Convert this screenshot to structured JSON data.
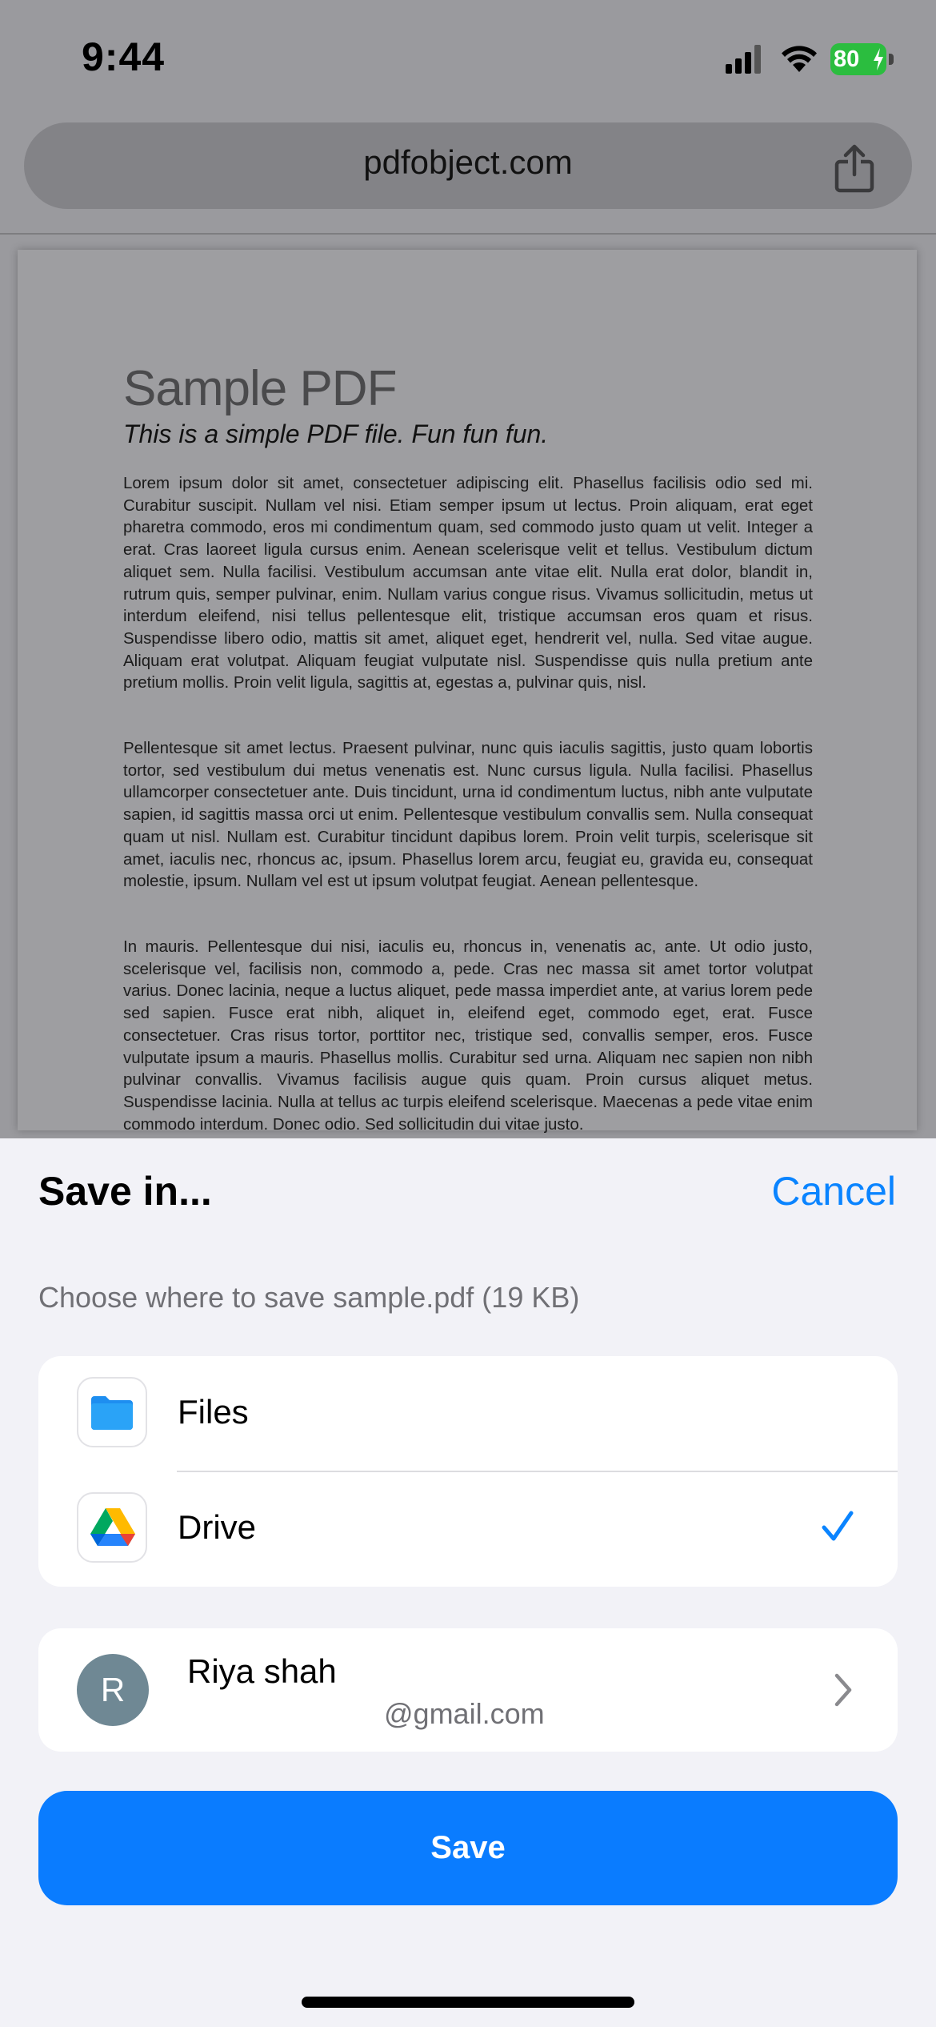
{
  "status_bar": {
    "time": "9:44",
    "battery": "80"
  },
  "browser": {
    "url": "pdfobject.com"
  },
  "pdf": {
    "title": "Sample PDF",
    "subtitle": "This is a simple PDF file. Fun fun fun.",
    "paragraphs": [
      "Lorem ipsum dolor sit amet, consectetuer adipiscing elit. Phasellus facilisis odio sed mi. Curabitur suscipit. Nullam vel nisi. Etiam semper ipsum ut lectus. Proin aliquam, erat eget pharetra commodo, eros mi condimentum quam, sed commodo justo quam ut velit. Integer a erat. Cras laoreet ligula cursus enim. Aenean scelerisque velit et tellus. Vestibulum dictum aliquet sem. Nulla facilisi. Vestibulum accumsan ante vitae elit. Nulla erat dolor, blandit in, rutrum quis, semper pulvinar, enim. Nullam varius congue risus. Vivamus sollicitudin, metus ut interdum eleifend, nisi tellus pellentesque elit, tristique accumsan eros quam et risus. Suspendisse libero odio, mattis sit amet, aliquet eget, hendrerit vel, nulla. Sed vitae augue. Aliquam erat volutpat. Aliquam feugiat vulputate nisl. Suspendisse quis nulla pretium ante pretium mollis. Proin velit ligula, sagittis at, egestas a, pulvinar quis, nisl.",
      "Pellentesque sit amet lectus. Praesent pulvinar, nunc quis iaculis sagittis, justo quam lobortis tortor, sed vestibulum dui metus venenatis est. Nunc cursus ligula. Nulla facilisi. Phasellus ullamcorper consectetuer ante. Duis tincidunt, urna id condimentum luctus, nibh ante vulputate sapien, id sagittis massa orci ut enim. Pellentesque vestibulum convallis sem. Nulla consequat quam ut nisl. Nullam est. Curabitur tincidunt dapibus lorem. Proin velit turpis, scelerisque sit amet, iaculis nec, rhoncus ac, ipsum. Phasellus lorem arcu, feugiat eu, gravida eu, consequat molestie, ipsum. Nullam vel est ut ipsum volutpat feugiat. Aenean pellentesque.",
      "In mauris. Pellentesque dui nisi, iaculis eu, rhoncus in, venenatis ac, ante. Ut odio justo, scelerisque vel, facilisis non, commodo a, pede. Cras nec massa sit amet tortor volutpat varius. Donec lacinia, neque a luctus aliquet, pede massa imperdiet ante, at varius lorem pede sed sapien. Fusce erat nibh, aliquet in, eleifend eget, commodo eget, erat. Fusce consectetuer. Cras risus tortor, porttitor nec, tristique sed, convallis semper, eros. Fusce vulputate ipsum a mauris. Phasellus mollis. Curabitur sed urna. Aliquam nec sapien non nibh pulvinar convallis. Vivamus facilisis augue quis quam. Proin cursus aliquet metus. Suspendisse lacinia. Nulla at tellus ac turpis eleifend scelerisque. Maecenas a pede vitae enim commodo interdum. Donec odio. Sed sollicitudin dui vitae justo."
    ]
  },
  "sheet": {
    "title": "Save in...",
    "cancel_label": "Cancel",
    "subtitle": "Choose where to save sample.pdf (19 KB)",
    "destinations": [
      {
        "label": "Files",
        "icon": "files-folder-icon",
        "selected": false
      },
      {
        "label": "Drive",
        "icon": "google-drive-icon",
        "selected": true
      }
    ],
    "account": {
      "initial": "R",
      "name": "Riya shah",
      "email": "@gmail.com"
    },
    "save_label": "Save"
  },
  "colors": {
    "accent": "#0a84ff",
    "save_button": "#0a7cff",
    "battery": "#2bbd3f",
    "avatar": "#6f8894"
  }
}
